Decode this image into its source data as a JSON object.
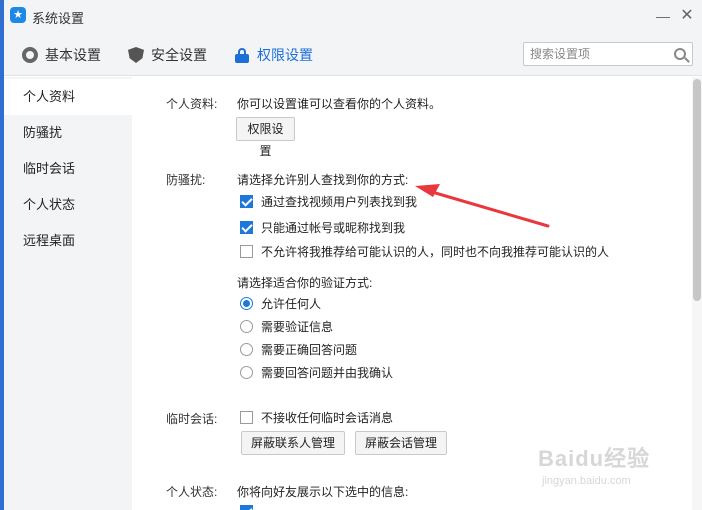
{
  "window": {
    "title": "系统设置",
    "minimize": "—",
    "close": "✕",
    "app_icon": "★"
  },
  "toolbar": {
    "basic_label": "基本设置",
    "security_label": "安全设置",
    "permission_label": "权限设置"
  },
  "search": {
    "placeholder": "搜索设置项",
    "value": ""
  },
  "sidebar": {
    "items": [
      {
        "label": "个人资料"
      },
      {
        "label": "防骚扰"
      },
      {
        "label": "临时会话"
      },
      {
        "label": "个人状态"
      },
      {
        "label": "远程桌面"
      }
    ]
  },
  "profile": {
    "label": "个人资料:",
    "description": "你可以设置谁可以查看你的个人资料。",
    "button": "权限设置"
  },
  "anti_harass": {
    "label": "防骚扰:",
    "prompt": "请选择允许别人查找到你的方式:",
    "options": [
      {
        "label": "通过查找视频用户列表找到我",
        "checked": true
      },
      {
        "label": "只能通过帐号或昵称找到我",
        "checked": true
      },
      {
        "label": "不允许将我推荐给可能认识的人，同时也不向我推荐可能认识的人",
        "checked": false
      }
    ],
    "verify_prompt": "请选择适合你的验证方式:",
    "verify_options": [
      {
        "label": "允许任何人",
        "selected": true
      },
      {
        "label": "需要验证信息",
        "selected": false
      },
      {
        "label": "需要正确回答问题",
        "selected": false
      },
      {
        "label": "需要回答问题并由我确认",
        "selected": false
      }
    ]
  },
  "temp_session": {
    "label": "临时会话:",
    "option": {
      "label": "不接收任何临时会话消息",
      "checked": false
    },
    "button_contacts": "屏蔽联系人管理",
    "button_sessions": "屏蔽会话管理"
  },
  "status": {
    "label": "个人状态:",
    "description": "你将向好友展示以下选中的信息:"
  },
  "colors": {
    "accent": "#1c6fd6",
    "checkbox": "#1e78d7",
    "arrow": "#e8383d"
  },
  "icons": {
    "basic": "gear-icon",
    "security": "shield-icon",
    "permission": "lock-icon",
    "search": "search-icon"
  },
  "watermark": {
    "logo": "Baidu经验",
    "url": "jingyan.baidu.com"
  }
}
